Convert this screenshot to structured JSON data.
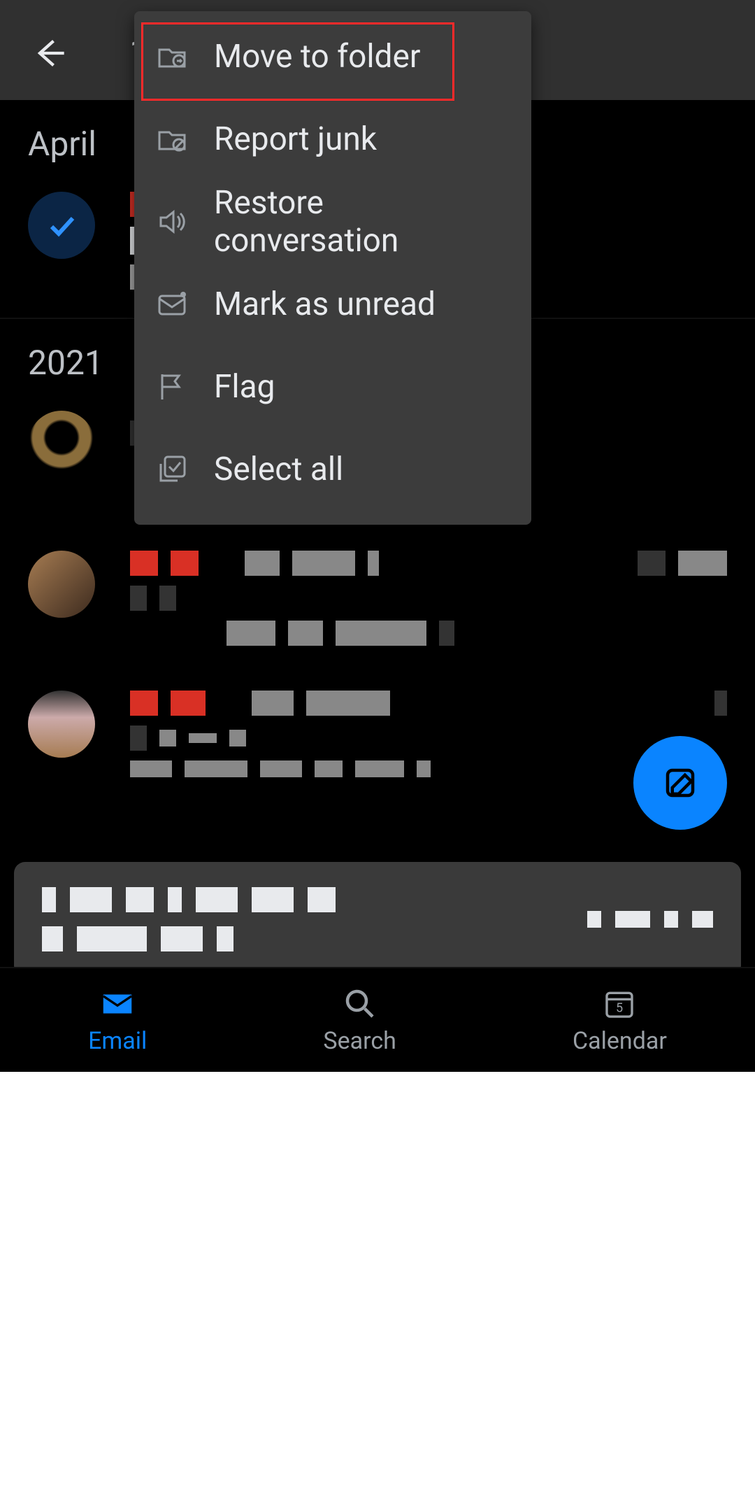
{
  "header": {
    "selected_count": "1"
  },
  "menu": {
    "items": [
      {
        "label": "Move to folder"
      },
      {
        "label": "Report junk"
      },
      {
        "label": "Restore conversation"
      },
      {
        "label": "Mark as unread"
      },
      {
        "label": "Flag"
      },
      {
        "label": "Select all"
      }
    ]
  },
  "sections": [
    {
      "label": "April"
    },
    {
      "label": "2021"
    }
  ],
  "nav": {
    "email": "Email",
    "search": "Search",
    "calendar": "Calendar",
    "calendar_day": "5"
  }
}
